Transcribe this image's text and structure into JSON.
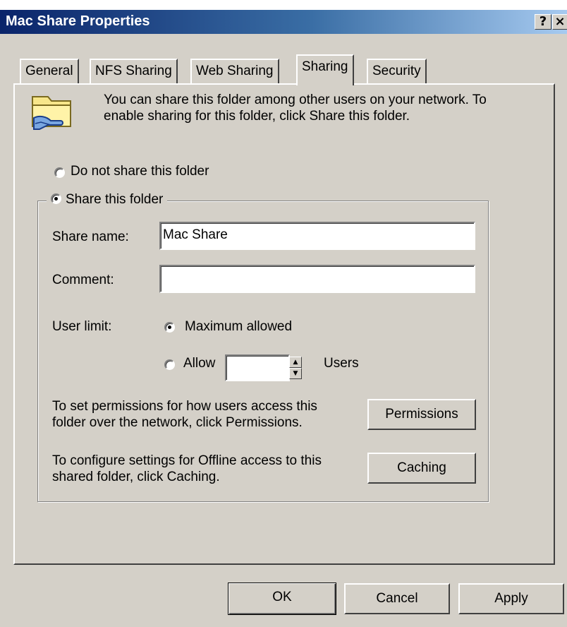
{
  "window": {
    "title": "Mac Share Properties",
    "help_glyph": "?",
    "close_glyph": "×"
  },
  "tabs": [
    {
      "label": "General",
      "active": false
    },
    {
      "label": "NFS Sharing",
      "active": false
    },
    {
      "label": "Web Sharing",
      "active": false
    },
    {
      "label": "Sharing",
      "active": true
    },
    {
      "label": "Security",
      "active": false
    }
  ],
  "sharing": {
    "info_text": "You can share this folder among other users on your network.  To enable sharing for this folder, click Share this folder.",
    "folder_icon": "shared-folder-icon",
    "do_not_share_label": "Do not share this folder",
    "share_label": "Share this folder",
    "selected_mode": "share",
    "share_name_label": "Share name:",
    "share_name_value": "Mac Share",
    "comment_label": "Comment:",
    "comment_value": "",
    "user_limit_label": "User limit:",
    "max_allowed_label": "Maximum allowed",
    "allow_label": "Allow",
    "allow_value": "",
    "users_label": "Users",
    "user_limit_selected": "maximum",
    "permissions_text": "To set permissions for how users access this folder over the network, click Permissions.",
    "permissions_button": "Permissions",
    "caching_text": "To configure settings for Offline access to this shared folder, click Caching.",
    "caching_button": "Caching"
  },
  "footer": {
    "ok": "OK",
    "cancel": "Cancel",
    "apply": "Apply"
  }
}
